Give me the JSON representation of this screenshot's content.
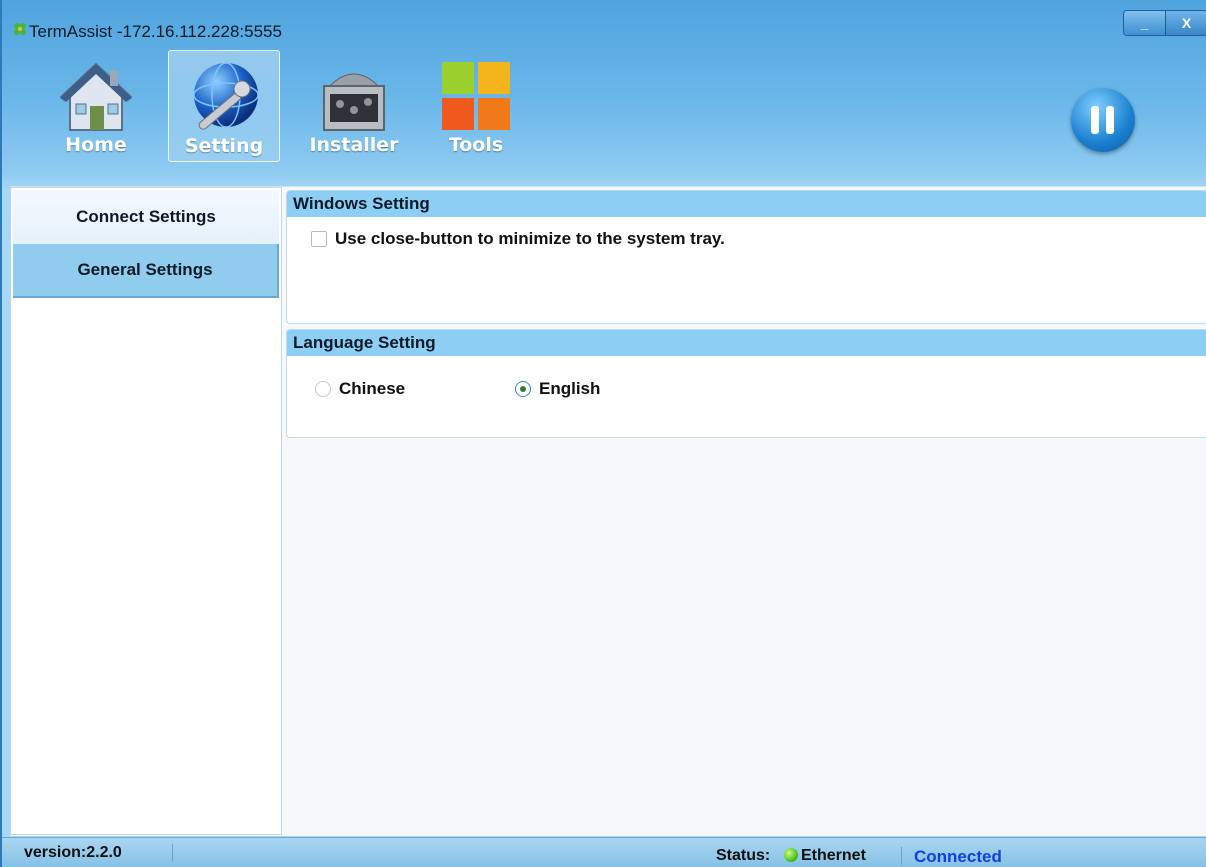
{
  "window": {
    "title": "TermAssist -172.16.112.228:5555",
    "minimize_label": "_",
    "close_label": "X"
  },
  "toolbar": {
    "items": [
      {
        "label": "Home",
        "icon": "house-icon",
        "active": false
      },
      {
        "label": "Setting",
        "icon": "globe-wrench-icon",
        "active": true
      },
      {
        "label": "Installer",
        "icon": "installer-box-icon",
        "active": false
      },
      {
        "label": "Tools",
        "icon": "tiles-icon",
        "active": false
      }
    ],
    "pause_icon": "pause-icon"
  },
  "sidebar": {
    "items": [
      {
        "label": "Connect Settings",
        "selected": false
      },
      {
        "label": "General Settings",
        "selected": true
      }
    ]
  },
  "windows_setting": {
    "title": "Windows Setting",
    "minimize_to_tray_label": "Use close-button to minimize to the system tray.",
    "minimize_to_tray_checked": false
  },
  "language_setting": {
    "title": "Language Setting",
    "options": [
      {
        "label": "Chinese",
        "selected": false
      },
      {
        "label": "English",
        "selected": true
      }
    ]
  },
  "statusbar": {
    "version": "version:2.2.0",
    "status_label": "Status:",
    "interface": "Ethernet",
    "connection": "Connected",
    "status_color": "#40b41a",
    "connection_color": "#1140d8"
  }
}
